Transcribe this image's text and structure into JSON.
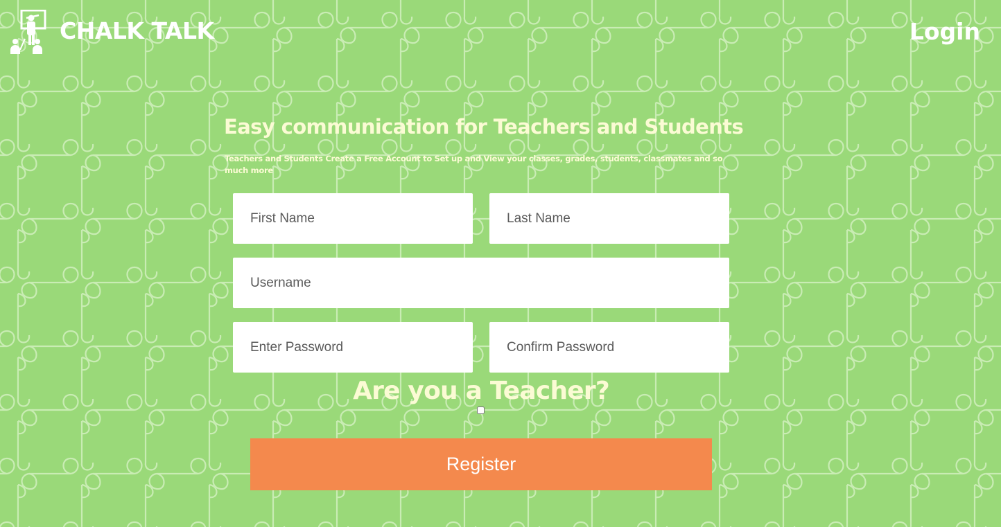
{
  "brand": {
    "name": "CHALK TALK",
    "logo_icon": "teacher-at-board-icon"
  },
  "nav": {
    "login_label": "Login"
  },
  "hero": {
    "headline": "Easy communication for Teachers and Students",
    "subline": "Teachers and Students Create a Free Account to Set up and View your classes, grades, students, classmates and so much more"
  },
  "form": {
    "first_name_placeholder": "First Name",
    "last_name_placeholder": "Last Name",
    "username_placeholder": "Username",
    "password_placeholder": "Enter Password",
    "confirm_password_placeholder": "Confirm Password",
    "teacher_question": "Are you a Teacher?",
    "teacher_checked": false,
    "register_label": "Register"
  },
  "colors": {
    "background": "#9ad979",
    "puzzle_lines": "#c9ecb4",
    "heading_text": "#fbfbd4",
    "button": "#f4894d",
    "white": "#ffffff"
  }
}
